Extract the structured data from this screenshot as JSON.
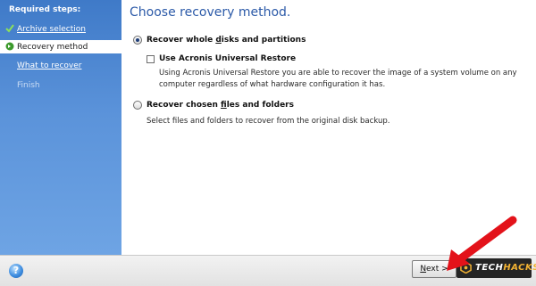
{
  "sidebar": {
    "heading": "Required steps:",
    "steps": [
      {
        "label": "Archive selection",
        "state": "done"
      },
      {
        "label": "Recovery method",
        "state": "current"
      },
      {
        "label": "What to recover",
        "state": "link"
      },
      {
        "label": "Finish",
        "state": "disabled"
      }
    ]
  },
  "main": {
    "title": "Choose recovery method.",
    "option_disks": {
      "label_pre": "Recover whole ",
      "label_ul": "d",
      "label_post": "isks and partitions",
      "selected": true
    },
    "universal_restore": {
      "label": "Use Acronis Universal Restore",
      "checked": false,
      "description_line1": "Using Acronis Universal Restore you are able to recover the image of a system volume on any",
      "description_line2": "computer regardless of what hardware configuration it has."
    },
    "option_files": {
      "label_pre": "Recover chosen ",
      "label_ul": "f",
      "label_post": "iles and folders",
      "selected": false,
      "description": "Select files and folders to recover from the original disk backup."
    }
  },
  "footer": {
    "help_label": "?",
    "next_label_ul": "N",
    "next_label_rest": "ext >"
  },
  "watermark": {
    "part1": "TECH",
    "part2": "HACKS"
  },
  "colors": {
    "sidebar_top": "#3f7ac8",
    "sidebar_bottom": "#6ea4e4",
    "title": "#2c5aa8",
    "arrow": "#e3121a",
    "watermark_accent": "#f2b233"
  }
}
